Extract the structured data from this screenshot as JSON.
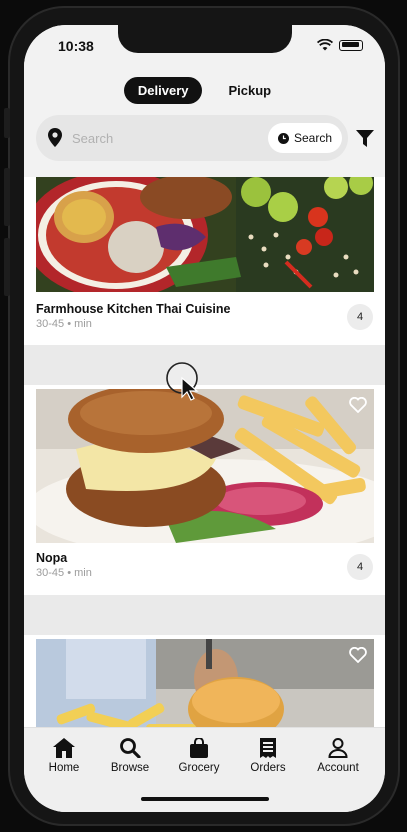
{
  "status_bar": {
    "time": "10:38"
  },
  "mode_toggle": {
    "delivery": "Delivery",
    "pickup": "Pickup",
    "active": "delivery"
  },
  "search": {
    "placeholder": "Search",
    "value": "",
    "button_label": "Search"
  },
  "restaurants": [
    {
      "name": "Farmhouse Kitchen Thai Cuisine",
      "time": "30-45",
      "separator": "•",
      "unit": "min",
      "rating": "4",
      "favorited": false
    },
    {
      "name": "Nopa",
      "time": "30-45",
      "separator": "•",
      "unit": "min",
      "rating": "4",
      "favorited": false
    },
    {
      "name": "",
      "time": "",
      "separator": "",
      "unit": "",
      "rating": "",
      "favorited": false
    }
  ],
  "tabs": [
    {
      "label": "Home",
      "icon": "home-icon"
    },
    {
      "label": "Browse",
      "icon": "search-icon"
    },
    {
      "label": "Grocery",
      "icon": "shopping-bag-icon"
    },
    {
      "label": "Orders",
      "icon": "receipt-icon"
    },
    {
      "label": "Account",
      "icon": "person-icon"
    }
  ],
  "colors": {
    "accent": "#111111",
    "background": "#ffffff",
    "surface": "#f2f2f2",
    "muted_text": "#9c9c9c"
  }
}
